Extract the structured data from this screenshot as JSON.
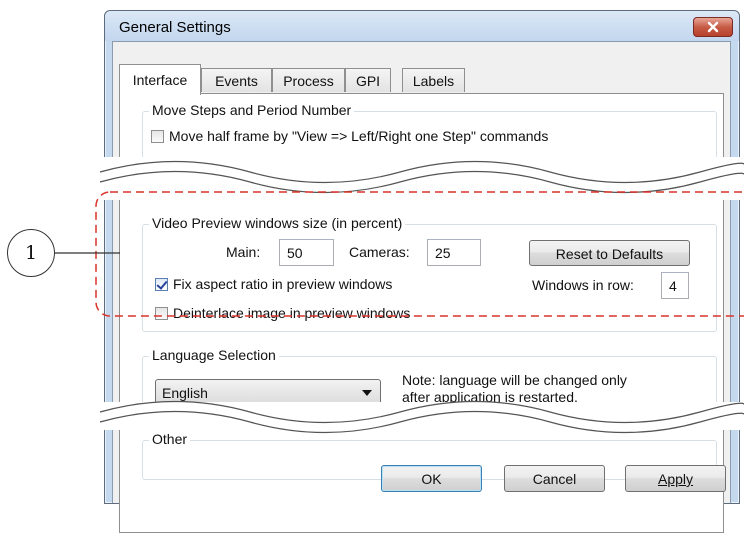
{
  "window": {
    "title": "General Settings",
    "close_icon": "close-icon",
    "close_color": "#c75c46"
  },
  "tabs": [
    {
      "label": "Interface",
      "active": true
    },
    {
      "label": "Events",
      "active": false
    },
    {
      "label": "Process",
      "active": false
    },
    {
      "label": "GPI",
      "active": false
    },
    {
      "label": "Labels",
      "active": false
    }
  ],
  "move_steps": {
    "legend": "Move Steps and Period Number",
    "half_frame": {
      "label": "Move half frame by \"View => Left/Right one Step\" commands",
      "checked": false
    }
  },
  "video_preview": {
    "legend": "Video Preview windows size (in percent)",
    "main_label": "Main:",
    "main_value": "50",
    "cameras_label": "Cameras:",
    "cameras_value": "25",
    "reset_button": "Reset to Defaults",
    "fix_aspect": {
      "label": "Fix aspect ratio in preview windows",
      "checked": true
    },
    "windows_in_row_label": "Windows in row:",
    "windows_in_row_value": "4",
    "deinterlace": {
      "label": "Deinterlace image in preview windows",
      "checked": false
    }
  },
  "language": {
    "legend": "Language Selection",
    "selected": "English",
    "note_line1": "Note: language will be changed only",
    "note_line2": "after application is restarted."
  },
  "other": {
    "legend": "Other"
  },
  "footer": {
    "ok": "OK",
    "cancel": "Cancel",
    "apply": "Apply"
  },
  "callout": {
    "number": "1",
    "highlight_color": "#d9342b"
  }
}
